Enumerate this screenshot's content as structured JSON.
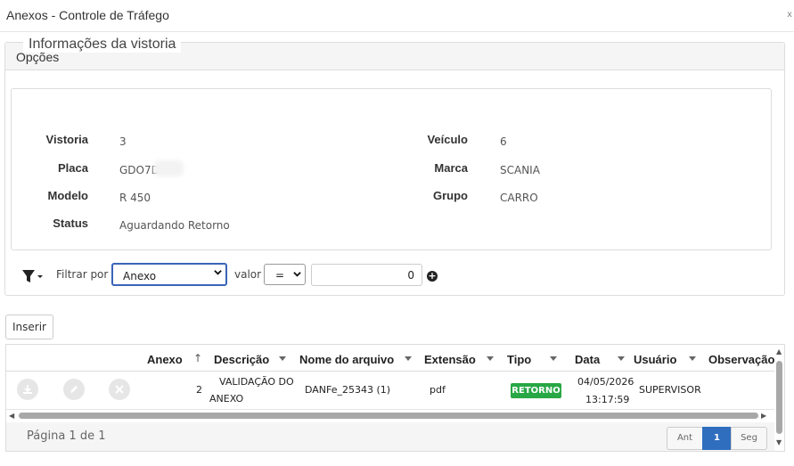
{
  "window": {
    "title": "Anexos - Controle de Tráfego",
    "close_glyph": "x"
  },
  "panel": {
    "title": "Opções"
  },
  "info": {
    "legend": "Informações da vistoria",
    "fields": {
      "vistoria": {
        "label": "Vistoria",
        "value": "3"
      },
      "placa": {
        "label": "Placa",
        "value": "GDO7D"
      },
      "modelo": {
        "label": "Modelo",
        "value": "R 450"
      },
      "status": {
        "label": "Status",
        "value": "Aguardando Retorno"
      },
      "veiculo": {
        "label": "Veículo",
        "value": "6"
      },
      "marca": {
        "label": "Marca",
        "value": "SCANIA"
      },
      "grupo": {
        "label": "Grupo",
        "value": "CARRO"
      }
    }
  },
  "filter": {
    "icon": "filter-icon",
    "filter_by_label": "Filtrar por",
    "field_selected": "Anexo",
    "value_label": "valor",
    "operator_selected": "=",
    "value": "0",
    "add_icon": "plus-circle-icon"
  },
  "toolbar": {
    "insert_label": "Inserir"
  },
  "grid": {
    "columns": {
      "anexo": "Anexo",
      "descricao": "Descrição",
      "nome_arquivo": "Nome do arquivo",
      "extensao": "Extensão",
      "tipo": "Tipo",
      "data": "Data",
      "usuario": "Usuário",
      "observacao": "Observação"
    },
    "sort_glyph": "↑",
    "rows": [
      {
        "anexo": "2",
        "descricao_line1": "VALIDAÇÃO DO",
        "descricao_line2": "ANEXO",
        "nome_arquivo": "DANFe_25343 (1)",
        "extensao": "pdf",
        "tipo": "RETORNO",
        "data_line1": "04/05/2026",
        "data_line2": "13:17:59",
        "usuario": "SUPERVISOR",
        "observacao": ""
      }
    ],
    "tipo_badge_color": "#28a745"
  },
  "pagination": {
    "info": "Página 1 de 1",
    "prev_label": "Ant",
    "current_page": "1",
    "next_label": "Seg"
  }
}
